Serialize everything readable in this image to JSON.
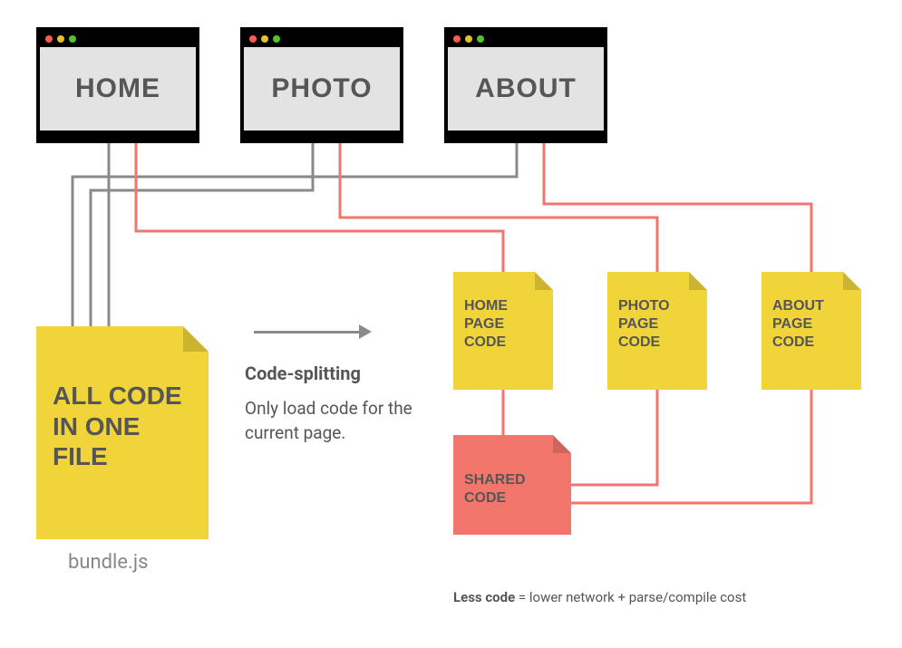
{
  "browsers": {
    "home": {
      "label": "HOME"
    },
    "photo": {
      "label": "PHOTO"
    },
    "about": {
      "label": "ABOUT"
    }
  },
  "files": {
    "all": {
      "label": "ALL CODE IN ONE FILE"
    },
    "home": {
      "label": "HOME PAGE CODE"
    },
    "photo": {
      "label": "PHOTO PAGE CODE"
    },
    "about": {
      "label": "ABOUT PAGE CODE"
    },
    "shared": {
      "label": "SHARED CODE"
    }
  },
  "center": {
    "heading": "Code-splitting",
    "body": "Only load code for the current page."
  },
  "captions": {
    "bundle": "bundle.js"
  },
  "footnote": {
    "bold": "Less code",
    "rest": " = lower network + parse/compile cost"
  },
  "colors": {
    "gray_line": "#8a8a8a",
    "red_line": "#f2766b",
    "yellow": "#f0d43a",
    "red_fill": "#f2766b"
  }
}
